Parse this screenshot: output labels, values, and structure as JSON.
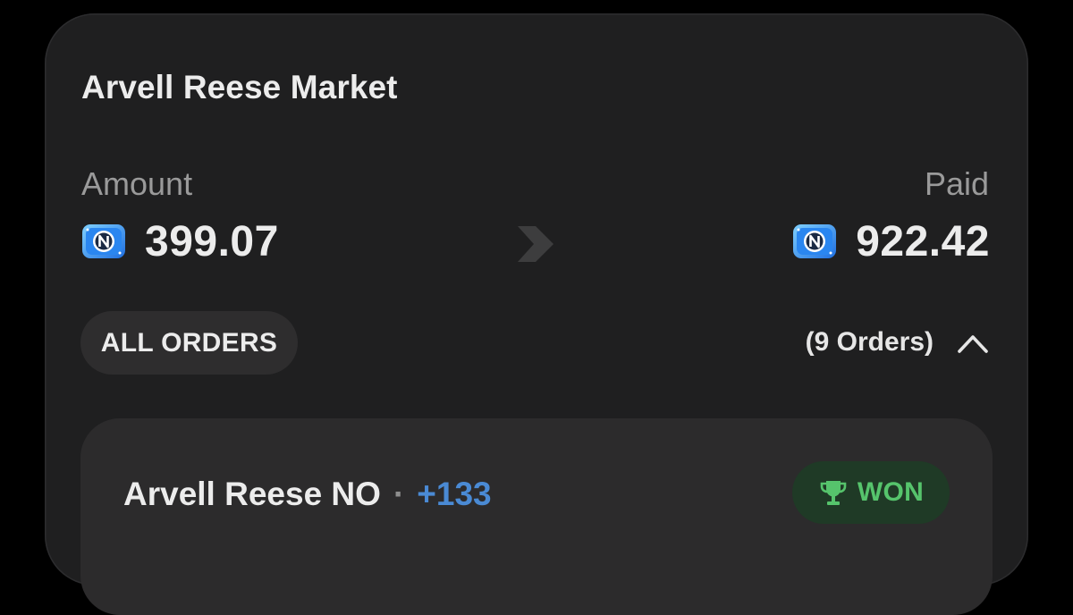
{
  "market": {
    "title": "Arvell Reese Market"
  },
  "summary": {
    "amount_label": "Amount",
    "amount_value": "399.07",
    "paid_label": "Paid",
    "paid_value": "922.42",
    "coin_icon": "n-coin-icon",
    "arrow_icon": "chevron-right-icon"
  },
  "orders": {
    "filter_label": "ALL ORDERS",
    "count_label": "(9 Orders)",
    "toggle_icon": "chevron-up-icon"
  },
  "order_item": {
    "title": "Arvell Reese NO",
    "separator": "·",
    "delta": "+133",
    "status_label": "WON",
    "status_icon": "trophy-icon",
    "colors": {
      "delta": "#4a8ad4",
      "status_text": "#56c46c",
      "status_bg": "#1f3a26"
    }
  }
}
